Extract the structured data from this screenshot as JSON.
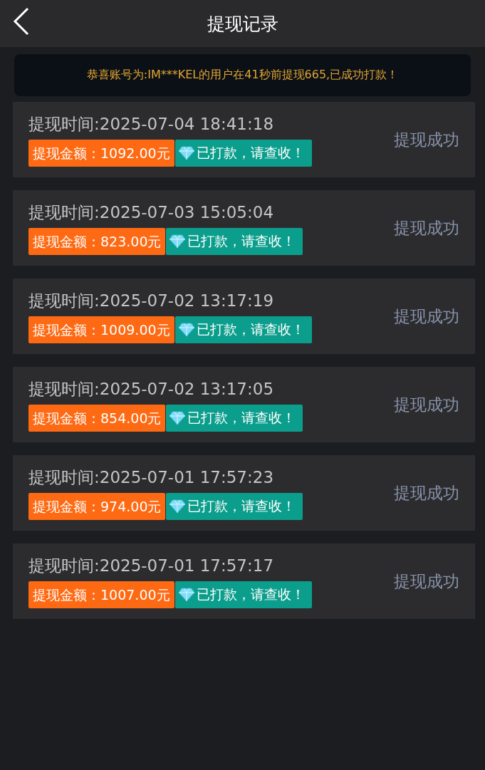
{
  "header": {
    "title": "提现记录"
  },
  "notice": {
    "text": "恭喜账号为:IM***KEL的用户在41秒前提现665,已成功打款！"
  },
  "records": [
    {
      "time": "提现时间:2025-07-04 18:41:18",
      "amount": "提现金额：1092.00元",
      "paid": "已打款，请查收！",
      "status": "提现成功"
    },
    {
      "time": "提现时间:2025-07-03 15:05:04",
      "amount": "提现金额：823.00元",
      "paid": "已打款，请查收！",
      "status": "提现成功"
    },
    {
      "time": "提现时间:2025-07-02 13:17:19",
      "amount": "提现金额：1009.00元",
      "paid": "已打款，请查收！",
      "status": "提现成功"
    },
    {
      "time": "提现时间:2025-07-02 13:17:05",
      "amount": "提现金额：854.00元",
      "paid": "已打款，请查收！",
      "status": "提现成功"
    },
    {
      "time": "提现时间:2025-07-01 17:57:23",
      "amount": "提现金额：974.00元",
      "paid": "已打款，请查收！",
      "status": "提现成功"
    },
    {
      "time": "提现时间:2025-07-01 17:57:17",
      "amount": "提现金额：1007.00元",
      "paid": "已打款，请查收！",
      "status": "提现成功"
    }
  ]
}
